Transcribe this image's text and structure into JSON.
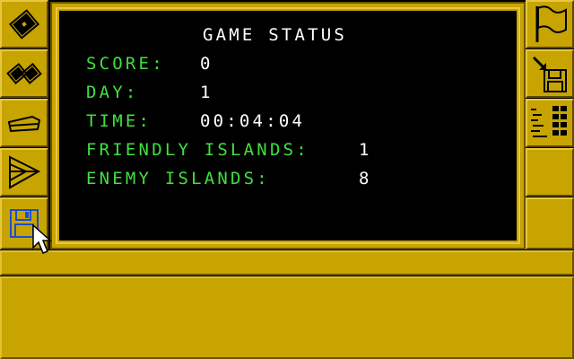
{
  "status_panel": {
    "title": "GAME STATUS",
    "rows": [
      {
        "label": "SCORE:",
        "value": "0"
      },
      {
        "label": "DAY:",
        "value": "1"
      },
      {
        "label": "TIME:",
        "value": "00:04:04"
      },
      {
        "label": "FRIENDLY ISLANDS:",
        "value": "1"
      },
      {
        "label": "ENEMY ISLANDS:",
        "value": "8"
      }
    ]
  },
  "left_buttons": [
    {
      "icon": "island-map-icon"
    },
    {
      "icon": "island-group-icon"
    },
    {
      "icon": "carrier-ship-icon"
    },
    {
      "icon": "funnel-icon"
    },
    {
      "icon": "floppy-disk-icon"
    }
  ],
  "right_buttons": [
    {
      "icon": "flag-icon"
    },
    {
      "icon": "load-disk-icon"
    },
    {
      "icon": "status-grid-icon"
    },
    {
      "icon": ""
    },
    {
      "icon": ""
    }
  ],
  "colors": {
    "panel_gold": "#c8a400",
    "label_green": "#3fe03f",
    "value_white": "#ffffff",
    "screen_black": "#000000"
  }
}
